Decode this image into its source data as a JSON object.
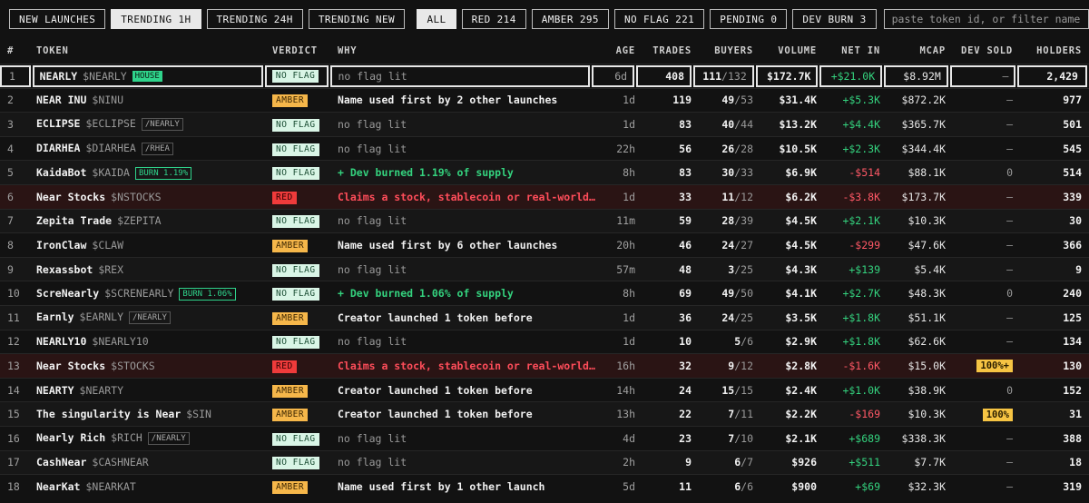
{
  "toolbar": {
    "tabs": [
      {
        "label": "NEW LAUNCHES",
        "active": false
      },
      {
        "label": "TRENDING 1H",
        "active": true
      },
      {
        "label": "TRENDING 24H",
        "active": false
      },
      {
        "label": "TRENDING NEW",
        "active": false
      }
    ],
    "filters": [
      {
        "label": "ALL",
        "active": true
      },
      {
        "label": "RED 214",
        "active": false
      },
      {
        "label": "AMBER 295",
        "active": false
      },
      {
        "label": "NO FLAG 221",
        "active": false
      },
      {
        "label": "PENDING 0",
        "active": false
      },
      {
        "label": "DEV BURN 3",
        "active": false
      }
    ],
    "search_placeholder": "paste token id, or filter name / symbol / c"
  },
  "columns": {
    "num": "#",
    "token": "TOKEN",
    "verdict": "VERDICT",
    "why": "WHY",
    "age": "AGE",
    "trades": "TRADES",
    "buyers": "BUYERS",
    "volume": "VOLUME",
    "netin": "NET IN",
    "mcap": "MCAP",
    "devsold": "DEV SOLD",
    "holders": "HOLDERS"
  },
  "colors": {
    "noflag": "#d9f5e6",
    "amber": "#f6b74a",
    "red": "#ef3b3b",
    "positive": "#34d27e",
    "negative": "#ff5866"
  },
  "rows": [
    {
      "num": "1",
      "name": "NEARLY",
      "symbol": "$NEARLY",
      "badge": "HOUSE",
      "badge_type": "house",
      "verdict": "NO FLAG",
      "vtype": "noflag",
      "why": "no flag lit",
      "wtype": "none",
      "age": "6d",
      "trades": "408",
      "buyers": "111",
      "buyers_total": "/132",
      "volume": "$172.7K",
      "netin": "+$21.0K",
      "ntype": "pos",
      "mcap": "$8.92M",
      "devsold": "–",
      "dtype": "dash",
      "holders": "2,429",
      "selected": true
    },
    {
      "num": "2",
      "name": "NEAR INU",
      "symbol": "$NINU",
      "badge": "",
      "badge_type": "",
      "verdict": "AMBER",
      "vtype": "amber",
      "why": "Name used first by 2 other launches",
      "wtype": "amber",
      "age": "1d",
      "trades": "119",
      "buyers": "49",
      "buyers_total": "/53",
      "volume": "$31.4K",
      "netin": "+$5.3K",
      "ntype": "pos",
      "mcap": "$872.2K",
      "devsold": "–",
      "dtype": "dash",
      "holders": "977"
    },
    {
      "num": "3",
      "name": "ECLIPSE",
      "symbol": "$ECLIPSE",
      "badge": "/NEARLY",
      "badge_type": "near",
      "verdict": "NO FLAG",
      "vtype": "noflag",
      "why": "no flag lit",
      "wtype": "none",
      "age": "1d",
      "trades": "83",
      "buyers": "40",
      "buyers_total": "/44",
      "volume": "$13.2K",
      "netin": "+$4.4K",
      "ntype": "pos",
      "mcap": "$365.7K",
      "devsold": "–",
      "dtype": "dash",
      "holders": "501"
    },
    {
      "num": "4",
      "name": "DIARHEA",
      "symbol": "$DIARHEA",
      "badge": "/RHEA",
      "badge_type": "near",
      "verdict": "NO FLAG",
      "vtype": "noflag",
      "why": "no flag lit",
      "wtype": "none",
      "age": "22h",
      "trades": "56",
      "buyers": "26",
      "buyers_total": "/28",
      "volume": "$10.5K",
      "netin": "+$2.3K",
      "ntype": "pos",
      "mcap": "$344.4K",
      "devsold": "–",
      "dtype": "dash",
      "holders": "545"
    },
    {
      "num": "5",
      "name": "KaidaBot",
      "symbol": "$KAIDA",
      "badge": "BURN 1.19%",
      "badge_type": "burn",
      "verdict": "NO FLAG",
      "vtype": "noflag",
      "why": "+ Dev burned 1.19% of supply",
      "wtype": "green",
      "age": "8h",
      "trades": "83",
      "buyers": "30",
      "buyers_total": "/33",
      "volume": "$6.9K",
      "netin": "-$514",
      "ntype": "neg",
      "mcap": "$88.1K",
      "devsold": "0",
      "dtype": "zero",
      "holders": "514"
    },
    {
      "num": "6",
      "name": "Near Stocks",
      "symbol": "$NSTOCKS",
      "badge": "",
      "badge_type": "",
      "verdict": "RED",
      "vtype": "red",
      "why": "Claims a stock, stablecoin or real-world…",
      "wtype": "red",
      "age": "1d",
      "trades": "33",
      "buyers": "11",
      "buyers_total": "/12",
      "volume": "$6.2K",
      "netin": "-$3.8K",
      "ntype": "neg",
      "mcap": "$173.7K",
      "devsold": "–",
      "dtype": "dash",
      "holders": "339",
      "rowred": true
    },
    {
      "num": "7",
      "name": "Zepita Trade",
      "symbol": "$ZEPITA",
      "badge": "",
      "badge_type": "",
      "verdict": "NO FLAG",
      "vtype": "noflag",
      "why": "no flag lit",
      "wtype": "none",
      "age": "11m",
      "trades": "59",
      "buyers": "28",
      "buyers_total": "/39",
      "volume": "$4.5K",
      "netin": "+$2.1K",
      "ntype": "pos",
      "mcap": "$10.3K",
      "devsold": "–",
      "dtype": "dash",
      "holders": "30"
    },
    {
      "num": "8",
      "name": "IronClaw",
      "symbol": "$CLAW",
      "badge": "",
      "badge_type": "",
      "verdict": "AMBER",
      "vtype": "amber",
      "why": "Name used first by 6 other launches",
      "wtype": "amber",
      "age": "20h",
      "trades": "46",
      "buyers": "24",
      "buyers_total": "/27",
      "volume": "$4.5K",
      "netin": "-$299",
      "ntype": "neg",
      "mcap": "$47.6K",
      "devsold": "–",
      "dtype": "dash",
      "holders": "366"
    },
    {
      "num": "9",
      "name": "Rexassbot",
      "symbol": "$REX",
      "badge": "",
      "badge_type": "",
      "verdict": "NO FLAG",
      "vtype": "noflag",
      "why": "no flag lit",
      "wtype": "none",
      "age": "57m",
      "trades": "48",
      "buyers": "3",
      "buyers_total": "/25",
      "volume": "$4.3K",
      "netin": "+$139",
      "ntype": "pos",
      "mcap": "$5.4K",
      "devsold": "–",
      "dtype": "dash",
      "holders": "9"
    },
    {
      "num": "10",
      "name": "ScreNearly",
      "symbol": "$SCRENEARLY",
      "badge": "BURN 1.06%",
      "badge_type": "burn",
      "verdict": "NO FLAG",
      "vtype": "noflag",
      "why": "+ Dev burned 1.06% of supply",
      "wtype": "green",
      "age": "8h",
      "trades": "69",
      "buyers": "49",
      "buyers_total": "/50",
      "volume": "$4.1K",
      "netin": "+$2.7K",
      "ntype": "pos",
      "mcap": "$48.3K",
      "devsold": "0",
      "dtype": "zero",
      "holders": "240"
    },
    {
      "num": "11",
      "name": "Earnly",
      "symbol": "$EARNLY",
      "badge": "/NEARLY",
      "badge_type": "near",
      "verdict": "AMBER",
      "vtype": "amber",
      "why": "Creator launched 1 token before",
      "wtype": "amber",
      "age": "1d",
      "trades": "36",
      "buyers": "24",
      "buyers_total": "/25",
      "volume": "$3.5K",
      "netin": "+$1.8K",
      "ntype": "pos",
      "mcap": "$51.1K",
      "devsold": "–",
      "dtype": "dash",
      "holders": "125"
    },
    {
      "num": "12",
      "name": "NEARLY10",
      "symbol": "$NEARLY10",
      "badge": "",
      "badge_type": "",
      "verdict": "NO FLAG",
      "vtype": "noflag",
      "why": "no flag lit",
      "wtype": "none",
      "age": "1d",
      "trades": "10",
      "buyers": "5",
      "buyers_total": "/6",
      "volume": "$2.9K",
      "netin": "+$1.8K",
      "ntype": "pos",
      "mcap": "$62.6K",
      "devsold": "–",
      "dtype": "dash",
      "holders": "134"
    },
    {
      "num": "13",
      "name": "Near Stocks",
      "symbol": "$STOCKS",
      "badge": "",
      "badge_type": "",
      "verdict": "RED",
      "vtype": "red",
      "why": "Claims a stock, stablecoin or real-world…",
      "wtype": "red",
      "age": "16h",
      "trades": "32",
      "buyers": "9",
      "buyers_total": "/12",
      "volume": "$2.8K",
      "netin": "-$1.6K",
      "ntype": "neg",
      "mcap": "$15.0K",
      "devsold": "100%+",
      "dtype": "badge",
      "holders": "130",
      "rowred": true
    },
    {
      "num": "14",
      "name": "NEARTY",
      "symbol": "$NEARTY",
      "badge": "",
      "badge_type": "",
      "verdict": "AMBER",
      "vtype": "amber",
      "why": "Creator launched 1 token before",
      "wtype": "amber",
      "age": "14h",
      "trades": "24",
      "buyers": "15",
      "buyers_total": "/15",
      "volume": "$2.4K",
      "netin": "+$1.0K",
      "ntype": "pos",
      "mcap": "$38.9K",
      "devsold": "0",
      "dtype": "zero",
      "holders": "152"
    },
    {
      "num": "15",
      "name": "The singularity is Near",
      "symbol": "$SIN",
      "badge": "",
      "badge_type": "",
      "verdict": "AMBER",
      "vtype": "amber",
      "why": "Creator launched 1 token before",
      "wtype": "amber",
      "age": "13h",
      "trades": "22",
      "buyers": "7",
      "buyers_total": "/11",
      "volume": "$2.2K",
      "netin": "-$169",
      "ntype": "neg",
      "mcap": "$10.3K",
      "devsold": "100%",
      "dtype": "badge",
      "holders": "31"
    },
    {
      "num": "16",
      "name": "Nearly Rich",
      "symbol": "$RICH",
      "badge": "/NEARLY",
      "badge_type": "near",
      "verdict": "NO FLAG",
      "vtype": "noflag",
      "why": "no flag lit",
      "wtype": "none",
      "age": "4d",
      "trades": "23",
      "buyers": "7",
      "buyers_total": "/10",
      "volume": "$2.1K",
      "netin": "+$689",
      "ntype": "pos",
      "mcap": "$338.3K",
      "devsold": "–",
      "dtype": "dash",
      "holders": "388"
    },
    {
      "num": "17",
      "name": "CashNear",
      "symbol": "$CASHNEAR",
      "badge": "",
      "badge_type": "",
      "verdict": "NO FLAG",
      "vtype": "noflag",
      "why": "no flag lit",
      "wtype": "none",
      "age": "2h",
      "trades": "9",
      "buyers": "6",
      "buyers_total": "/7",
      "volume": "$926",
      "netin": "+$511",
      "ntype": "pos",
      "mcap": "$7.7K",
      "devsold": "–",
      "dtype": "dash",
      "holders": "18"
    },
    {
      "num": "18",
      "name": "NearKat",
      "symbol": "$NEARKAT",
      "badge": "",
      "badge_type": "",
      "verdict": "AMBER",
      "vtype": "amber",
      "why": "Name used first by 1 other launch",
      "wtype": "amber",
      "age": "5d",
      "trades": "11",
      "buyers": "6",
      "buyers_total": "/6",
      "volume": "$900",
      "netin": "+$69",
      "ntype": "pos",
      "mcap": "$32.3K",
      "devsold": "–",
      "dtype": "dash",
      "holders": "319"
    }
  ]
}
